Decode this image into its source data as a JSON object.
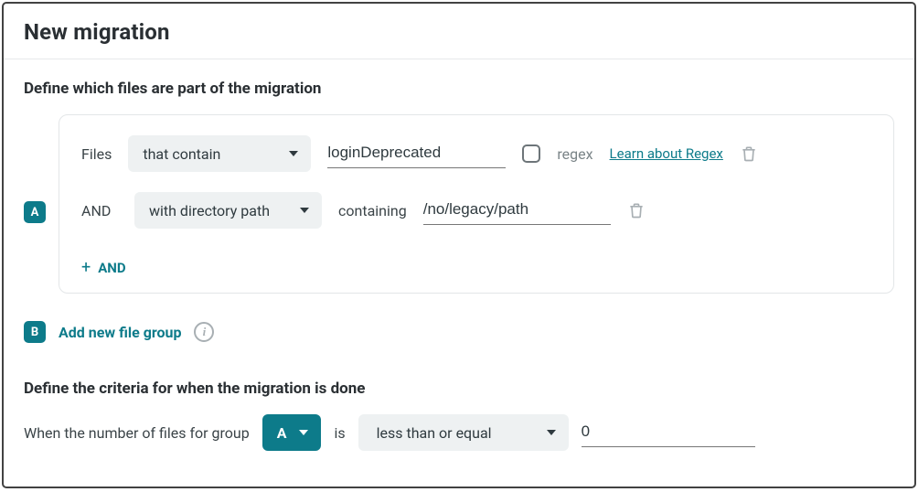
{
  "page": {
    "title": "New migration"
  },
  "sections": {
    "define_files_title": "Define which files are part of the migration",
    "define_criteria_title": "Define the criteria for when the migration is done"
  },
  "groups": [
    {
      "badge": "A",
      "rules": [
        {
          "prefix": "Files",
          "match_type": "that contain",
          "value": "loginDeprecated",
          "regex_checked": false,
          "regex_label": "regex",
          "learn_link": "Learn about Regex"
        },
        {
          "prefix": "AND",
          "match_type": "with directory path",
          "sub_label": "containing",
          "value": "/no/legacy/path"
        }
      ],
      "add_and_label": "AND"
    }
  ],
  "add_group": {
    "badge": "B",
    "label": "Add new file group"
  },
  "criteria": {
    "sentence_prefix": "When the number of files for group",
    "group": "A",
    "is_label": "is",
    "operator": "less than or equal",
    "value": "0"
  }
}
